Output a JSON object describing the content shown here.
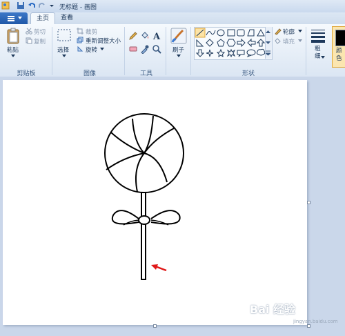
{
  "window": {
    "title": "无标题 - 画图"
  },
  "tabs": [
    {
      "label": "主页",
      "active": true
    },
    {
      "label": "查看",
      "active": false
    }
  ],
  "ribbon": {
    "clipboard": {
      "paste": "粘贴",
      "cut": "剪切",
      "copy": "复制",
      "group": "剪贴板"
    },
    "image": {
      "select": "选择",
      "crop": "裁剪",
      "resize": "重新调整大小",
      "rotate": "旋转",
      "group": "图像"
    },
    "tools": {
      "group": "工具"
    },
    "brushes": {
      "label": "刷子"
    },
    "shapes": {
      "outline": "轮廓",
      "fill": "填充",
      "group": "形状"
    },
    "size": {
      "label": "粗\n细"
    },
    "colors": {
      "label": "颜\n色"
    }
  },
  "watermark": {
    "text": "Bai 经验",
    "sub": "jingyan.baidu.com"
  },
  "colors": {
    "accent": "#2b6cc4",
    "arrow": "#e01818"
  }
}
